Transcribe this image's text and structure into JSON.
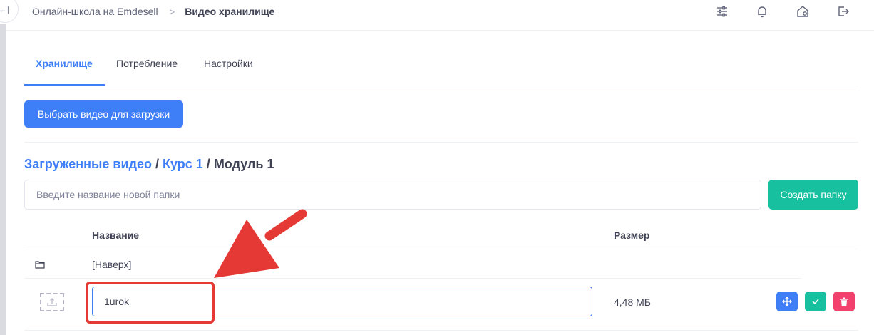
{
  "topbar": {
    "breadcrumb_root": "Онлайн-школа на Emdesell",
    "breadcrumb_sep": ">",
    "breadcrumb_current": "Видео хранилище",
    "collapse_glyph": "←|",
    "icons": [
      "sliders-icon",
      "bell-icon",
      "home-settings-icon",
      "logout-icon"
    ]
  },
  "tabs": [
    {
      "label": "Хранилище",
      "active": true
    },
    {
      "label": "Потребление",
      "active": false
    },
    {
      "label": "Настройки",
      "active": false
    }
  ],
  "upload_button": "Выбрать видео для загрузки",
  "path": {
    "root": "Загруженные видео",
    "sep": " / ",
    "course": "Курс 1",
    "module": "Модуль 1"
  },
  "new_folder": {
    "placeholder": "Введите название новой папки",
    "value": "",
    "button": "Создать папку"
  },
  "table": {
    "col_name": "Название",
    "col_size": "Размер",
    "up_row_label": "[Наверх]",
    "file_row": {
      "name_value": "1urok",
      "size": "4,48 МБ"
    }
  },
  "colors": {
    "primary": "#3e7ef7",
    "success": "#17c1a0",
    "danger": "#f1416c",
    "annotation": "#e53935"
  }
}
